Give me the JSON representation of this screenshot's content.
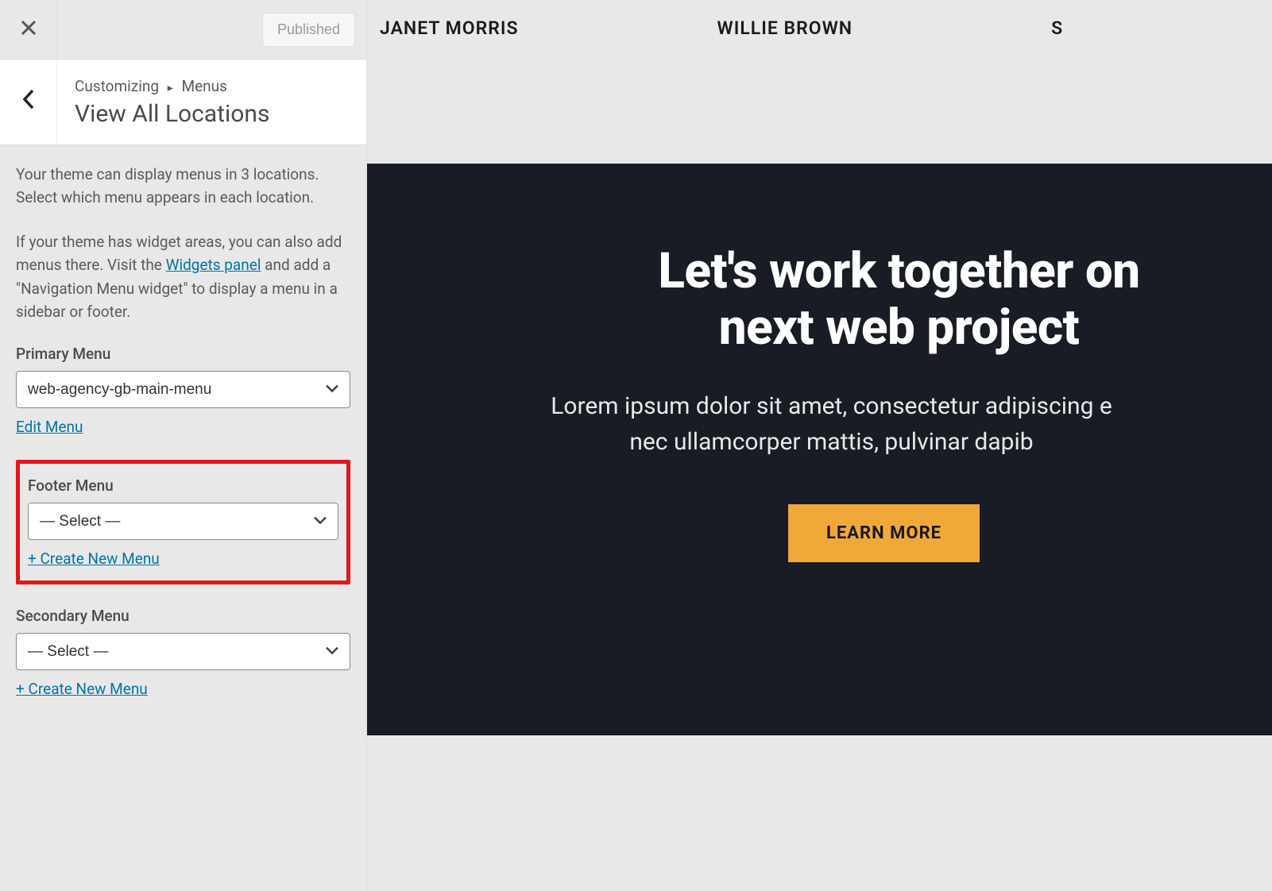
{
  "topbar": {
    "published_label": "Published"
  },
  "breadcrumb": {
    "parent": "Customizing",
    "current": "Menus",
    "title": "View All Locations"
  },
  "intro": {
    "p1": "Your theme can display menus in 3 locations. Select which menu appears in each location.",
    "p2_a": "If your theme has widget areas, you can also add menus there. Visit the ",
    "link": "Widgets panel",
    "p2_b": " and add a \"Navigation Menu widget\" to display a menu in a sidebar or footer."
  },
  "menus": {
    "primary": {
      "label": "Primary Menu",
      "value": "web-agency-gb-main-menu",
      "action": "Edit Menu"
    },
    "footer": {
      "label": "Footer Menu",
      "value": "— Select —",
      "action": "+ Create New Menu"
    },
    "secondary": {
      "label": "Secondary Menu",
      "value": "— Select —",
      "action": "+ Create New Menu"
    }
  },
  "preview": {
    "nav": {
      "item1": "JANET MORRIS",
      "item2": "WILLIE BROWN",
      "item3": "S"
    },
    "hero": {
      "title_l1": "Let's work together on",
      "title_l2": "next web project",
      "sub_l1": "Lorem ipsum dolor sit amet, consectetur adipiscing e",
      "sub_l2": "nec ullamcorper mattis, pulvinar dapib",
      "cta": "LEARN MORE"
    }
  }
}
